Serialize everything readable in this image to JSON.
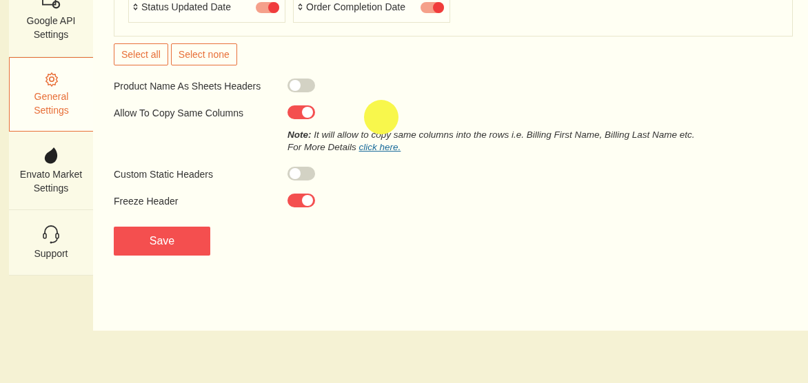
{
  "sidebar": {
    "items": [
      {
        "label": "Google API Settings",
        "kind": "api",
        "selected": false
      },
      {
        "label": "General Settings",
        "kind": "gear",
        "selected": true
      },
      {
        "label": "Envato Market Settings",
        "kind": "leaf",
        "selected": false
      },
      {
        "label": "Support",
        "kind": "headset",
        "selected": false
      }
    ]
  },
  "columns": [
    {
      "label": "Status Updated Date",
      "on": true
    },
    {
      "label": "Order Completion Date",
      "on": true
    }
  ],
  "column_buttons": [
    "Select all",
    "Select none"
  ],
  "settings": [
    {
      "label": "Product Name As Sheets Headers",
      "on": false
    },
    {
      "label": "Allow To Copy Same Columns",
      "on": true,
      "note": {
        "text": "**Note:** *It will allow to copy same columns into the rows i.e. Billing First Name, Billing Last Name etc.*",
        "details": "For More Details",
        "link": "click here."
      }
    },
    {
      "label": "Custom Static Headers",
      "on": false
    },
    {
      "label": "Freeze Header",
      "on": true
    }
  ],
  "save_button": "Save"
}
